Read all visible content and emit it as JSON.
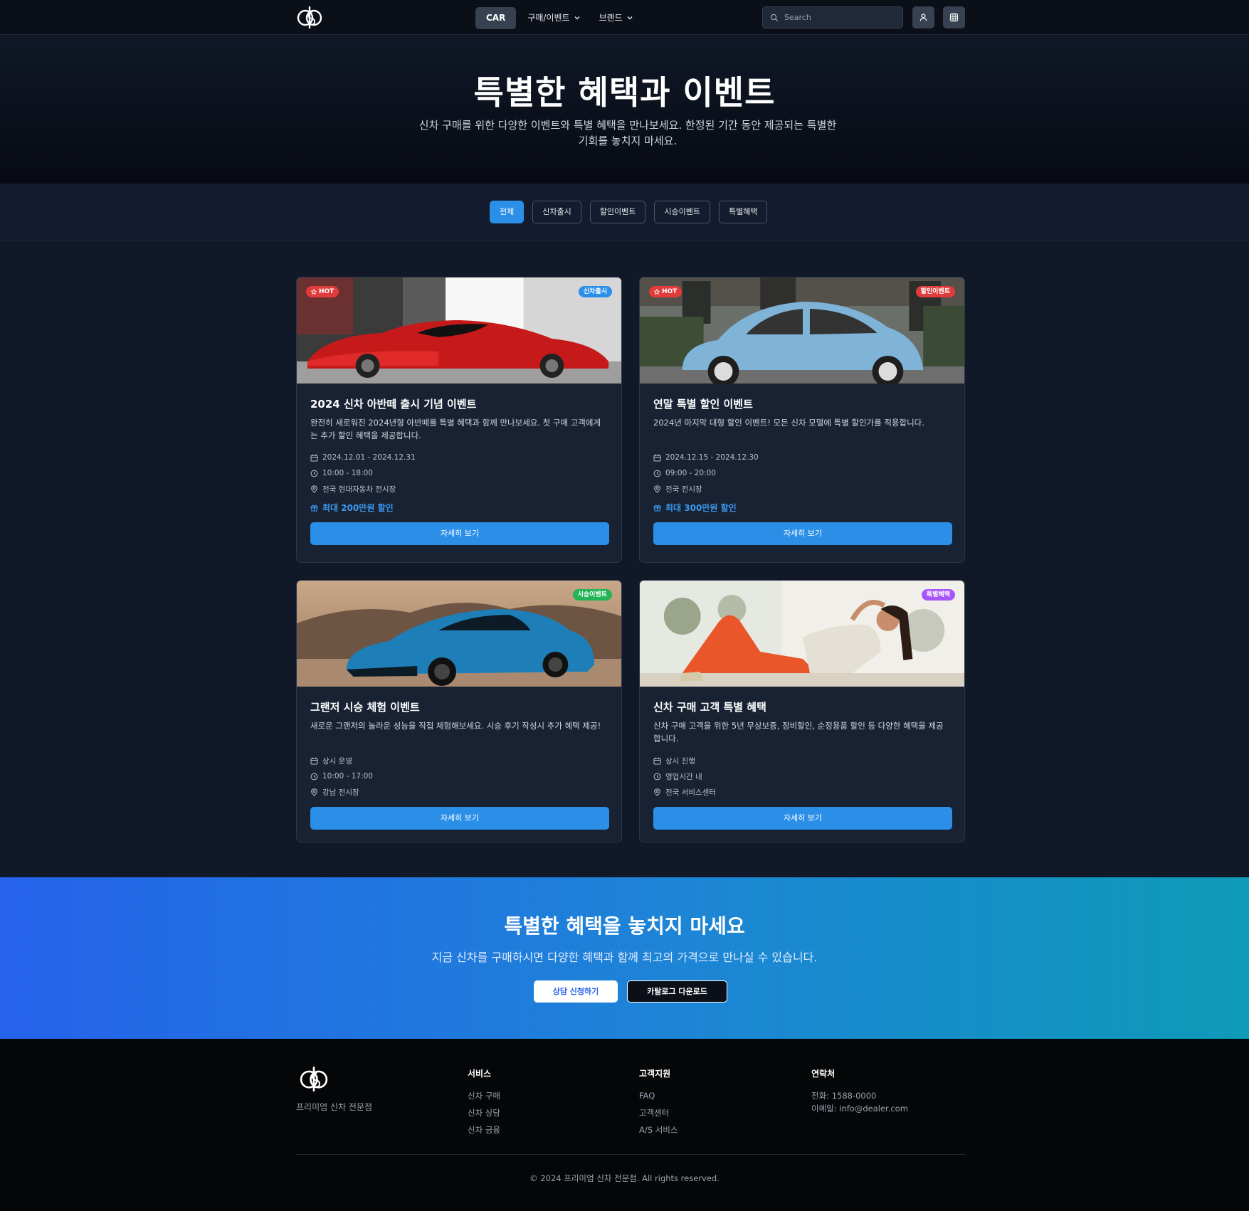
{
  "nav": {
    "brand_label": "CAR",
    "menu": [
      {
        "label": "구매/이벤트"
      },
      {
        "label": "브랜드"
      }
    ],
    "search_placeholder": "Search"
  },
  "hero": {
    "title": "특별한 혜택과 이벤트",
    "subtitle": "신차 구매를 위한 다양한 이벤트와 특별 혜택을 만나보세요. 한정된 기간 동안 제공되는 특별한 기회를 놓치지 마세요."
  },
  "filters": [
    "전체",
    "신차출시",
    "할인이벤트",
    "시승이벤트",
    "특별혜택"
  ],
  "active_filter": "전체",
  "cards": [
    {
      "hot": "HOT",
      "category": "신차출시",
      "category_color": "#2b8fe8",
      "title": "2024 신차 아반떼 출시 기념 이벤트",
      "desc": "완전히 새로워진 2024년형 아반떼를 특별 혜택과 함께 만나보세요. 첫 구매 고객에게는 추가 할인 혜택을 제공합니다.",
      "date": "2024.12.01 - 2024.12.31",
      "time": "10:00 - 18:00",
      "place": "전국 현대자동차 전시장",
      "discount": "최대 200만원 할인",
      "button": "자세히 보기"
    },
    {
      "hot": "HOT",
      "category": "할인이벤트",
      "category_color": "#e23b3b",
      "title": "연말 특별 할인 이벤트",
      "desc": "2024년 마지막 대형 할인 이벤트! 모든 신차 모델에 특별 할인가를 적용합니다.",
      "date": "2024.12.15 - 2024.12.30",
      "time": "09:00 - 20:00",
      "place": "전국 전시장",
      "discount": "최대 300만원 할인",
      "button": "자세히 보기"
    },
    {
      "hot": "",
      "category": "시승이벤트",
      "category_color": "#22b455",
      "title": "그랜저 시승 체험 이벤트",
      "desc": "새로운 그랜저의 놀라운 성능을 직접 체험해보세요. 시승 후기 작성시 추가 혜택 제공!",
      "date": "상시 운영",
      "time": "10:00 - 17:00",
      "place": "강남 전시장",
      "discount": "",
      "button": "자세히 보기"
    },
    {
      "hot": "",
      "category": "특별혜택",
      "category_color": "#a855f7",
      "title": "신차 구매 고객 특별 혜택",
      "desc": "신차 구매 고객을 위한 5년 무상보증, 정비할인, 순정용품 할인 등 다양한 혜택을 제공합니다.",
      "date": "상시 진행",
      "time": "영업시간 내",
      "place": "전국 서비스센터",
      "discount": "",
      "button": "자세히 보기"
    }
  ],
  "promo": {
    "title": "특별한 혜택을 놓치지 마세요",
    "subtitle": "지금 신차를 구매하시면 다양한 혜택과 함께 최고의 가격으로 만나실 수 있습니다.",
    "primary_button": "상담 신청하기",
    "secondary_button": "카탈로그 다운로드"
  },
  "footer": {
    "tagline": "프리미엄 신차 전문점",
    "columns": [
      {
        "title": "서비스",
        "links": [
          "신차 구매",
          "신차 상담",
          "신차 금융"
        ]
      },
      {
        "title": "고객지원",
        "links": [
          "FAQ",
          "고객센터",
          "A/S 서비스"
        ]
      }
    ],
    "contact": {
      "title": "연락처",
      "phone": "전화: 1588-0000",
      "email": "이메일: info@dealer.com"
    },
    "copyright": "© 2024 프리미엄 신차 전문점. All rights reserved."
  },
  "icons": {
    "logo": "car-dealer-logo-icon",
    "account": "user-icon",
    "apps": "grid-icon",
    "search": "search-icon",
    "date": "calendar-icon",
    "time": "clock-icon",
    "place": "map-pin-icon",
    "discount": "gift-icon",
    "hot": "star-icon"
  }
}
